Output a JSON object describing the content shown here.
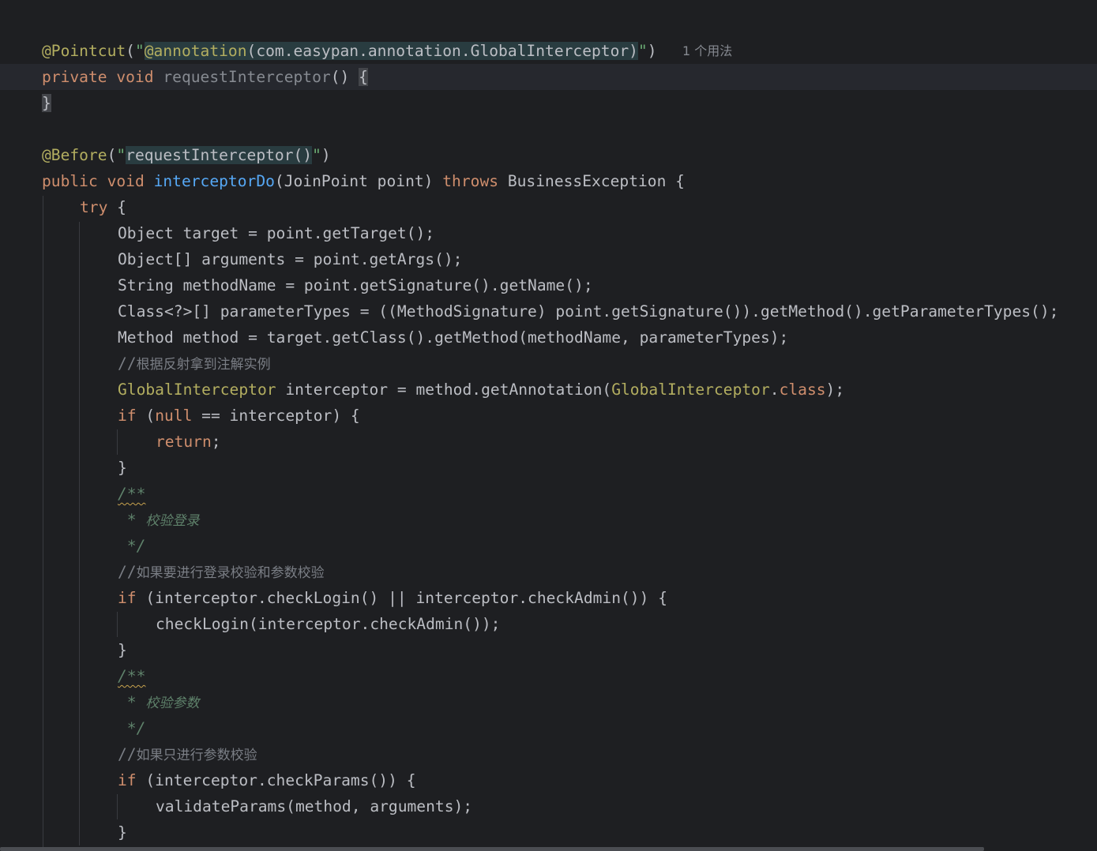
{
  "editor": {
    "usage_hint": "1 个用法",
    "lines": {
      "l01": {
        "ann": "@Pointcut",
        "open": "(",
        "q1": "\"",
        "inj_ann": "@annotation",
        "inj_rest": "(com.easypan.annotation.GlobalInterceptor)",
        "q2": "\"",
        "close": ")"
      },
      "l02": {
        "kw": "private void ",
        "name": "requestInterceptor",
        "params": "() ",
        "brace": "{"
      },
      "l03": {
        "brace": "}"
      },
      "l05": {
        "ann": "@Before",
        "open": "(",
        "q1": "\"",
        "inj": "requestInterceptor()",
        "q2": "\"",
        "close": ")"
      },
      "l06": {
        "kw": "public void ",
        "name": "interceptorDo",
        "params": "(JoinPoint point) ",
        "throws": "throws",
        "rest": " BusinessException {"
      },
      "l07": {
        "kw": "try",
        "rest": " {"
      },
      "l08": {
        "text": "Object target = point.getTarget();"
      },
      "l09": {
        "text": "Object[] arguments = point.getArgs();"
      },
      "l10": {
        "text": "String methodName = point.getSignature().getName();"
      },
      "l11": {
        "text": "Class<?>[] parameterTypes = ((MethodSignature) point.getSignature()).getMethod().getParameterTypes();"
      },
      "l12": {
        "text": "Method method = target.getClass().getMethod(methodName, parameterTypes);"
      },
      "l13": {
        "slashes": "//",
        "text": "根据反射拿到注解实例"
      },
      "l14": {
        "cls1": "GlobalInterceptor",
        "mid": " interceptor = method.getAnnotation(",
        "cls2": "GlobalInterceptor",
        "dot": ".",
        "kw": "class",
        "end": ");"
      },
      "l15": {
        "kw1": "if",
        "p1": " (",
        "kw2": "null",
        "rest": " == interceptor) {"
      },
      "l16": {
        "kw": "return",
        "end": ";"
      },
      "l17": {
        "text": "}"
      },
      "l18": {
        "text": "/**"
      },
      "l19": {
        "star": " * ",
        "text": "校验登录"
      },
      "l20": {
        "text": " */"
      },
      "l21": {
        "slashes": "//",
        "text": "如果要进行登录校验和参数校验"
      },
      "l22": {
        "kw": "if",
        "rest": " (interceptor.checkLogin() || interceptor.checkAdmin()) {"
      },
      "l23": {
        "text": "checkLogin(interceptor.checkAdmin());"
      },
      "l24": {
        "text": "}"
      },
      "l25": {
        "text": "/**"
      },
      "l26": {
        "star": " * ",
        "text": "校验参数"
      },
      "l27": {
        "text": " */"
      },
      "l28": {
        "slashes": "//",
        "text": "如果只进行参数校验"
      },
      "l29": {
        "kw": "if",
        "rest": " (interceptor.checkParams()) {"
      },
      "l30": {
        "text": "validateParams(method, arguments);"
      },
      "l31": {
        "text": "}"
      }
    }
  }
}
